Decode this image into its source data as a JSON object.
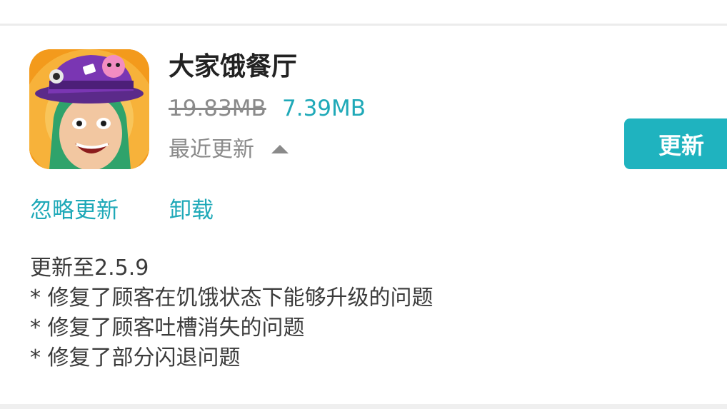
{
  "app": {
    "name": "大家饿餐厅",
    "icon_name": "app-icon-chef-character",
    "size_old": "19.83MB",
    "size_new": "7.39MB",
    "recent_update_label": "最近更新",
    "recent_update_icon": "caret-up-icon"
  },
  "actions": {
    "update_label": "更新",
    "ignore_update_label": "忽略更新",
    "uninstall_label": "卸载"
  },
  "release_notes": {
    "version_line": "更新至2.5.9",
    "items": [
      "* 修复了顾客在饥饿状态下能够升级的问题",
      "* 修复了顾客吐槽消失的问题",
      "* 修复了部分闪退问题"
    ]
  },
  "colors": {
    "accent": "#1fa9b8",
    "button": "#1fb3bf",
    "muted": "#8a8a8a",
    "title": "#222222"
  }
}
